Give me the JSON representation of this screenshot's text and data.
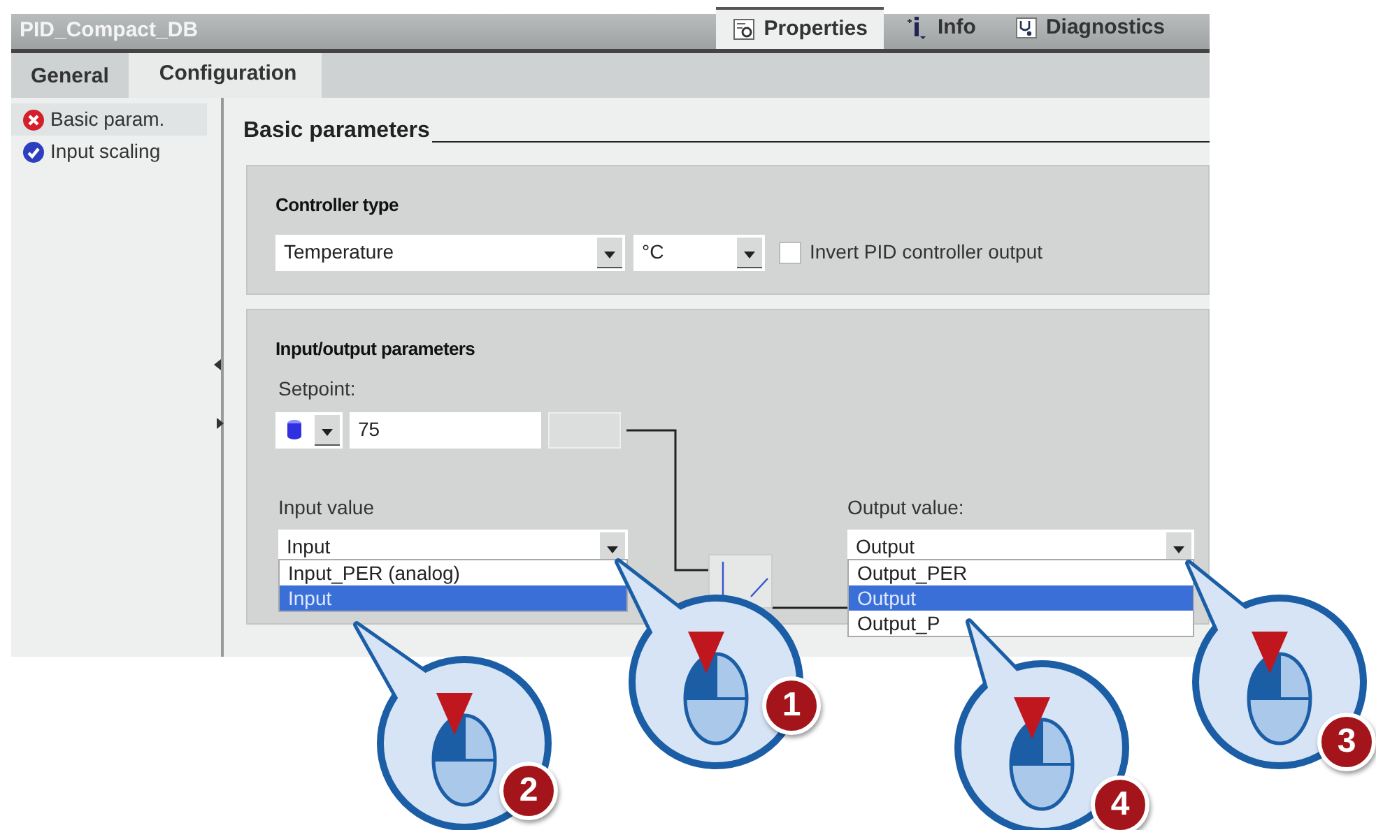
{
  "window": {
    "title": "PID_Compact_DB"
  },
  "inspector_tabs": [
    {
      "label": "Properties",
      "selected": true,
      "kind": "properties"
    },
    {
      "label": "Info",
      "selected": false,
      "kind": "info"
    },
    {
      "label": "Diagnostics",
      "selected": false,
      "kind": "diagnostics"
    }
  ],
  "tabs": [
    {
      "label": "General",
      "selected": false
    },
    {
      "label": "Configuration",
      "selected": true
    }
  ],
  "sidebar": {
    "items": [
      {
        "label": "Basic param.",
        "kind": "error",
        "selected": true
      },
      {
        "label": "Input scaling",
        "kind": "ok",
        "selected": false
      }
    ]
  },
  "section_title": "Basic parameters",
  "controller_type": {
    "heading": "Controller type",
    "type_value": "Temperature",
    "unit_value": "°C",
    "invert": {
      "label": "Invert PID controller output",
      "checked": false
    }
  },
  "io_parameters": {
    "heading": "Input/output parameters",
    "setpoint_label": "Setpoint:",
    "setpoint_value": "75",
    "input": {
      "label": "Input value",
      "value": "Input",
      "options": [
        {
          "label": "Input_PER (analog)",
          "selected": false
        },
        {
          "label": "Input",
          "selected": true
        }
      ]
    },
    "output": {
      "label": "Output value:",
      "value": "Output",
      "options": [
        {
          "label": "Output_PER",
          "selected": false
        },
        {
          "label": "Output",
          "selected": true
        },
        {
          "label": "Output_P",
          "selected": false
        }
      ]
    }
  },
  "callouts": [
    {
      "number": "1"
    },
    {
      "number": "2"
    },
    {
      "number": "3"
    },
    {
      "number": "4"
    }
  ]
}
